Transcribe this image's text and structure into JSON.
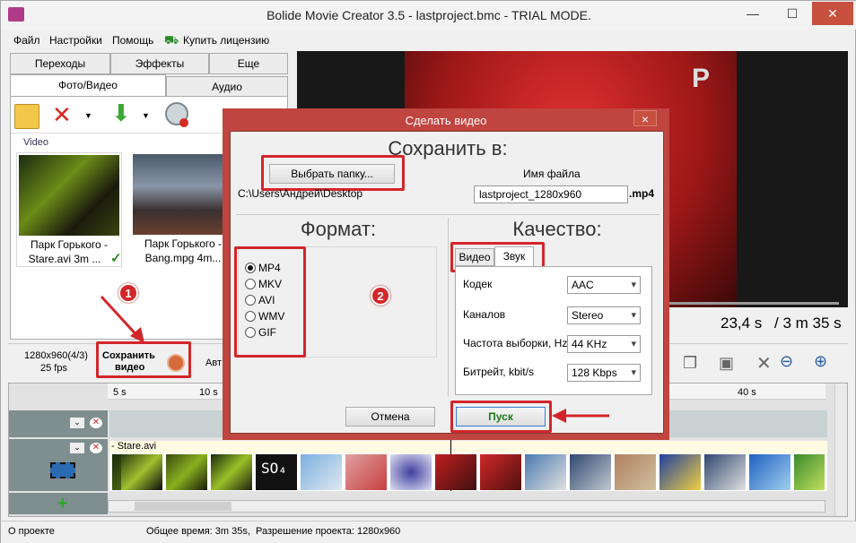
{
  "window": {
    "title": "Bolide Movie Creator 3.5 - lastproject.bmc  - TRIAL MODE."
  },
  "menu": {
    "items": [
      "Файл",
      "Настройки",
      "Помощь",
      "Купить лицензию"
    ]
  },
  "left_tabs": {
    "row1": [
      "Переходы",
      "Эффекты",
      "Еще"
    ],
    "row2": [
      "Фото/Видео",
      "Аудио"
    ]
  },
  "library": {
    "section_label": "Video",
    "items": [
      {
        "line1": "Парк Горького -",
        "line2": "Stare.avi 3m ..."
      },
      {
        "line1": "Парк Горького -",
        "line2": "Bang.mpg 4m..."
      }
    ]
  },
  "preview": {
    "time_current": "23,4 s",
    "time_total": "/ 3 m 35 s"
  },
  "project_bar": {
    "resolution": "1280x960(4/3)",
    "fps": "25 fps",
    "save_video_line1": "Сохранить",
    "save_video_line2": "видео",
    "cut_text": "Авт"
  },
  "timeline": {
    "ticks": [
      "5 s",
      "10 s",
      "40 s"
    ],
    "clip_label": "- Stare.avi"
  },
  "status": {
    "about": "О проекте",
    "total_time": "Общее время: 3m 35s,",
    "resolution": "Разрешение проекта:  1280x960"
  },
  "dialog": {
    "title": "Сделать видео",
    "close": "×",
    "save_in_heading": "Сохранить в:",
    "choose_folder": "Выбрать папку...",
    "path": "C:\\Users\\Андрей\\Desktop",
    "filename_label": "Имя файла",
    "filename_value": "lastproject_1280x960",
    "extension": ".mp4",
    "format_heading": "Формат:",
    "formats": [
      "MP4",
      "MKV",
      "AVI",
      "WMV",
      "GIF"
    ],
    "selected_format": "MP4",
    "quality_heading": "Качество:",
    "quality_tabs": [
      "Видео",
      "Звук"
    ],
    "active_quality_tab": "Звук",
    "fields": [
      {
        "label": "Кодек",
        "value": "AAC"
      },
      {
        "label": "Каналов",
        "value": "Stereo"
      },
      {
        "label": "Частота выборки, Hz",
        "value": "44 KHz"
      },
      {
        "label": "Битрейт, kbit/s",
        "value": "128 Kbps"
      }
    ],
    "cancel": "Отмена",
    "start": "Пуск"
  },
  "annotations": {
    "badge1": "1",
    "badge2": "2"
  },
  "colors": {
    "highlight": "#d2262a",
    "dialog_frame": "#c0443f",
    "start_text": "#1a7a1a"
  }
}
